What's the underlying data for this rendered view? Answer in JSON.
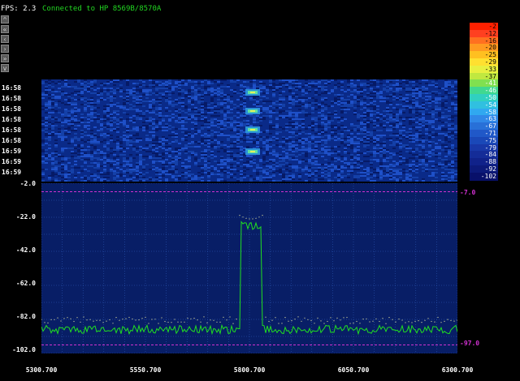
{
  "header": {
    "fps": "FPS: 2.3",
    "status": "Connected to HP 8569B/8570A"
  },
  "nav": {
    "buttons": [
      "^",
      "«",
      "‹",
      "›",
      "»",
      "v"
    ]
  },
  "waterfall": {
    "times": [
      "16:58",
      "16:58",
      "16:58",
      "16:58",
      "16:58",
      "16:58",
      "16:59",
      "16:59",
      "16:59"
    ]
  },
  "legend": {
    "levels": [
      "-2",
      "-12",
      "-16",
      "-20",
      "-25",
      "-29",
      "-33",
      "-37",
      "-41",
      "-46",
      "-50",
      "-54",
      "-58",
      "-63",
      "-67",
      "-71",
      "-75",
      "-79",
      "-84",
      "-88",
      "-92",
      "-102"
    ],
    "colors": [
      "#ff2000",
      "#ff4020",
      "#ff7020",
      "#ff9a20",
      "#ffc020",
      "#ffe030",
      "#e8f040",
      "#c0e840",
      "#80e050",
      "#40d890",
      "#30d0c0",
      "#30c0e0",
      "#30a8f0",
      "#3088e8",
      "#2870d8",
      "#2058c8",
      "#1a48b8",
      "#1838a8",
      "#142c98",
      "#10228a",
      "#0c1a7a",
      "#08106a"
    ]
  },
  "spectrum": {
    "y_ticks": [
      "-2.0",
      "-22.0",
      "-42.0",
      "-62.0",
      "-82.0",
      "-102.0"
    ],
    "x_ticks": [
      "5300.700",
      "5550.700",
      "5800.700",
      "6050.700",
      "6300.700"
    ],
    "ref_high": "-7.0",
    "ref_low": "-97.0",
    "colors": {
      "background": "#081e66",
      "grid": "#3060c0",
      "trace": "#20e020",
      "peak_hold": "#e0e0a0",
      "ref": "#d030d0"
    }
  }
}
